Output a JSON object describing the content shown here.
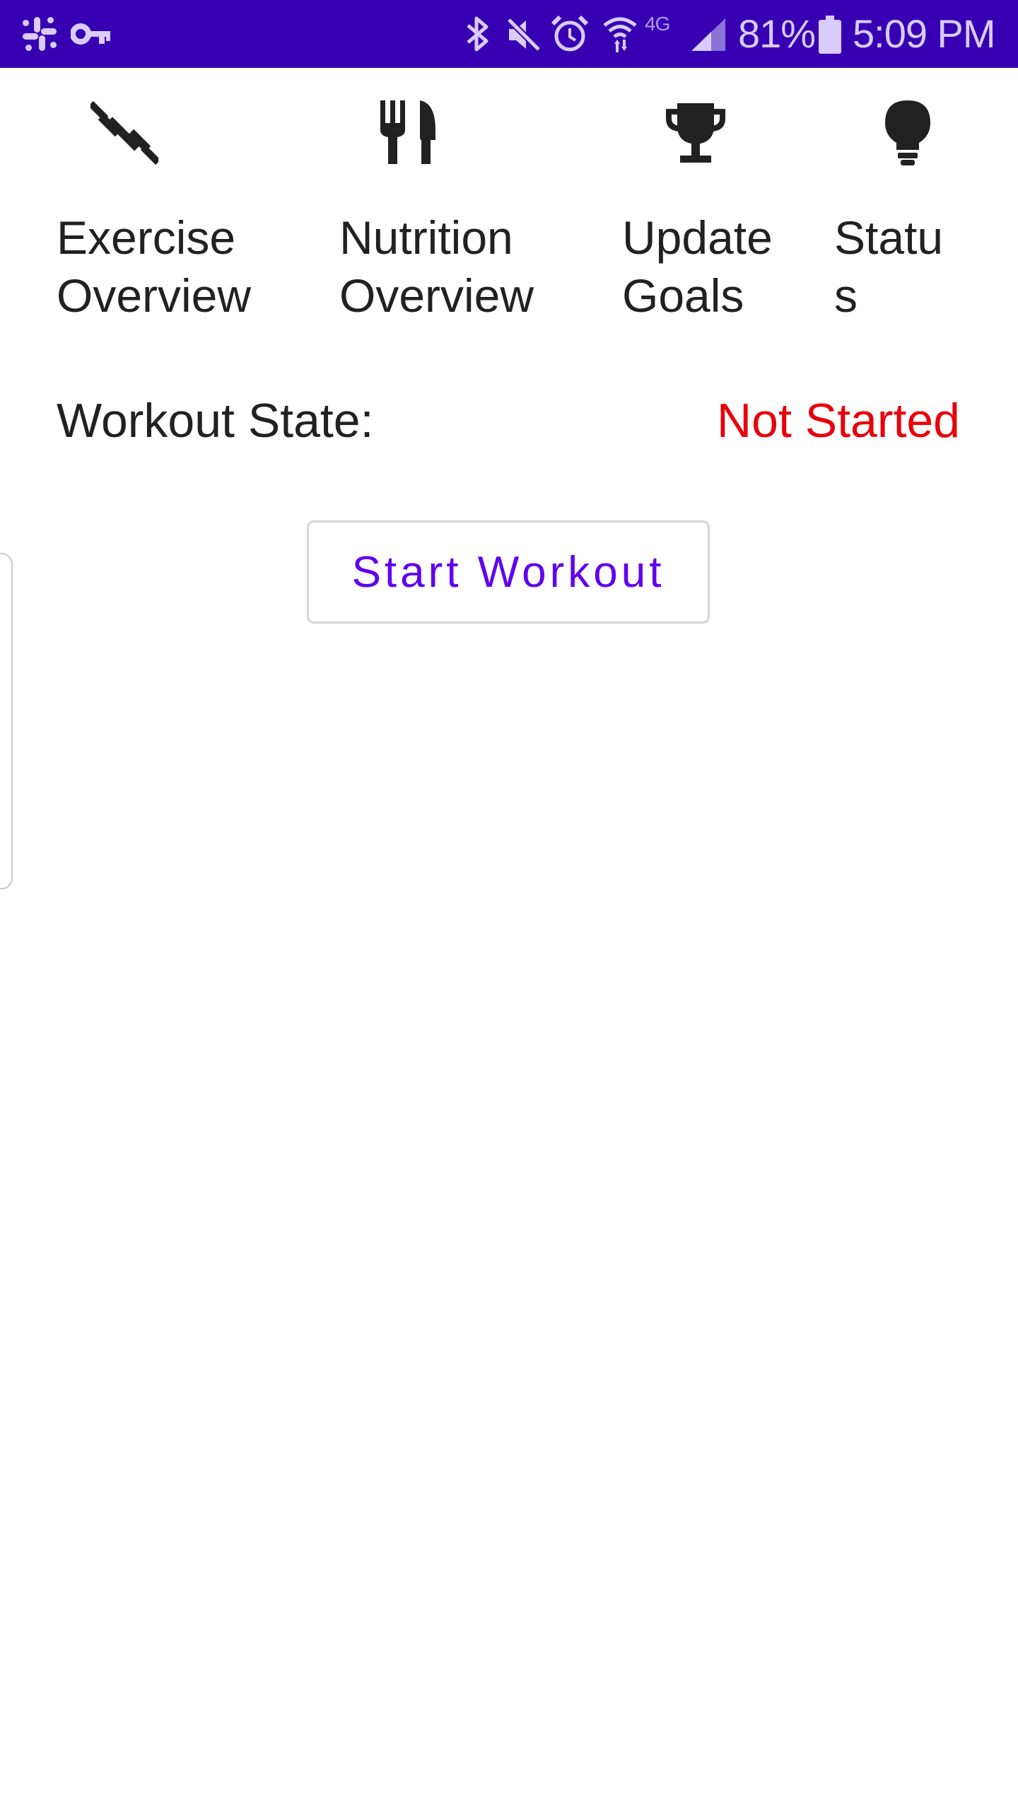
{
  "status_bar": {
    "battery_percent": "81%",
    "time": "5:09 PM",
    "network_badge": "4G",
    "background_color": "#3700b3",
    "icons": [
      "slack-icon",
      "vpn-key-icon",
      "bluetooth-icon",
      "mute-icon",
      "alarm-icon",
      "wifi-icon",
      "cell-signal-icon",
      "battery-icon"
    ]
  },
  "nav": {
    "items": [
      {
        "label": "Exercise\nOverview",
        "icon": "dumbbell-icon"
      },
      {
        "label": "Nutrition\nOverview",
        "icon": "fork-knife-icon"
      },
      {
        "label": "Update\nGoals",
        "icon": "trophy-icon"
      },
      {
        "label": "Statu\ns",
        "icon": "lightbulb-icon"
      }
    ]
  },
  "workout": {
    "state_label": "Workout State:",
    "state_value": "Not Started",
    "state_value_color": "#e8000b",
    "start_button_label": "Start Workout",
    "button_text_color": "#6200ee"
  }
}
